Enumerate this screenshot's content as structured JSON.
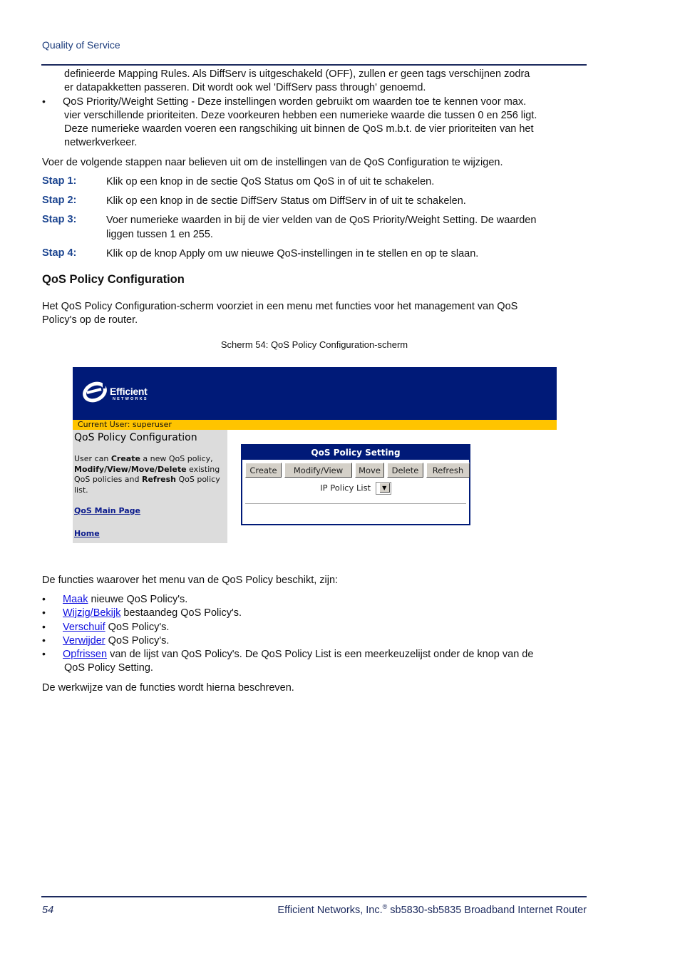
{
  "header": {
    "running_title": "Quality of Service"
  },
  "intro": {
    "continued_text_1": "definieerde Mapping Rules. Als DiffServ is uitgeschakeld (OFF), zullen er geen tags verschijnen zodra",
    "continued_text_2": "er datapakketten passeren. Dit wordt ook wel 'DiffServ pass through' genoemd.",
    "bullet_line_1": "QoS Priority/Weight Setting - Deze instellingen worden gebruikt om waarden toe te kennen voor max.",
    "bullet_line_2": "vier verschillende prioriteiten. Deze voorkeuren hebben een numerieke waarde die tussen 0 en 256 ligt.",
    "bullet_line_3": "Deze numerieke waarden voeren een rangschiking uit binnen de QoS m.b.t. de vier prioriteiten van het",
    "bullet_line_4": "netwerkverkeer.",
    "steps_intro": "Voer de volgende stappen naar believen uit om de instellingen van de QoS Configuration te wijzigen."
  },
  "steps": [
    {
      "label": "Stap 1:",
      "text": "Klik op een knop in de sectie QoS Status om QoS in of uit te schakelen."
    },
    {
      "label": "Stap 2:",
      "text": "Klik op een knop in de sectie DiffServ Status om DiffServ in of uit te schakelen."
    },
    {
      "label": "Stap 3:",
      "text": "Voer numerieke waarden in bij de vier velden van de QoS Priority/Weight Setting. De waarden",
      "text2": "liggen tussen 1 en 255."
    },
    {
      "label": "Stap 4:",
      "text": "Klik op de knop Apply om uw nieuwe QoS-instellingen in te stellen en op te slaan."
    }
  ],
  "section": {
    "heading": "QoS Policy Configuration",
    "para_1": "Het QoS Policy Configuration-scherm voorziet in een menu met functies voor het management van QoS",
    "para_2": "Policy's op de router.",
    "caption": "Scherm 54: QoS Policy Configuration-scherm"
  },
  "screenshot": {
    "brand_name": "Efficient",
    "brand_sub": "NETWORKS",
    "current_user": "Current User: superuser",
    "left_title": "QoS Policy Configuration",
    "desc_1a": "User can ",
    "desc_1b": "Create",
    "desc_1c": " a new QoS policy,",
    "desc_2a": "Modify/View/Move/Delete",
    "desc_2b": " existing",
    "desc_3a": "QoS policies and ",
    "desc_3b": "Refresh",
    "desc_3c": " QoS policy",
    "desc_4": "list.",
    "link_main": "QoS Main Page",
    "link_home": "Home",
    "panel_title": "QoS Policy Setting",
    "buttons": [
      "Create",
      "Modify/View",
      "Move",
      "Delete",
      "Refresh"
    ],
    "ip_policy_label": "IP Policy List",
    "ip_policy_value": "",
    "colors": {
      "banner": "#001a78",
      "userbar": "#ffc400",
      "panel_bg": "#dcdcdc"
    }
  },
  "functions": {
    "intro": "De functies waarover het menu van de QoS Policy beschikt, zijn:",
    "items": [
      {
        "link": "Maak",
        "text": " nieuwe QoS Policy's."
      },
      {
        "link": "Wijzig/Bekijk",
        "text": " bestaandeg QoS Policy's."
      },
      {
        "link": "Verschuif",
        "text": " QoS Policy's."
      },
      {
        "link": "Verwijder",
        "text": " QoS Policy's."
      },
      {
        "link": "Opfrissen",
        "text": " van de lijst van QoS Policy's. De QoS Policy List is een meerkeuzelijst onder de knop van de",
        "text2": "QoS Policy Setting."
      }
    ],
    "outro": "De werkwijze van de functies wordt hierna beschreven."
  },
  "footer": {
    "page_number": "54",
    "company": "Efficient Networks, Inc.",
    "registered": "®",
    "product": " sb5830-sb5835 Broadband Internet Router"
  }
}
